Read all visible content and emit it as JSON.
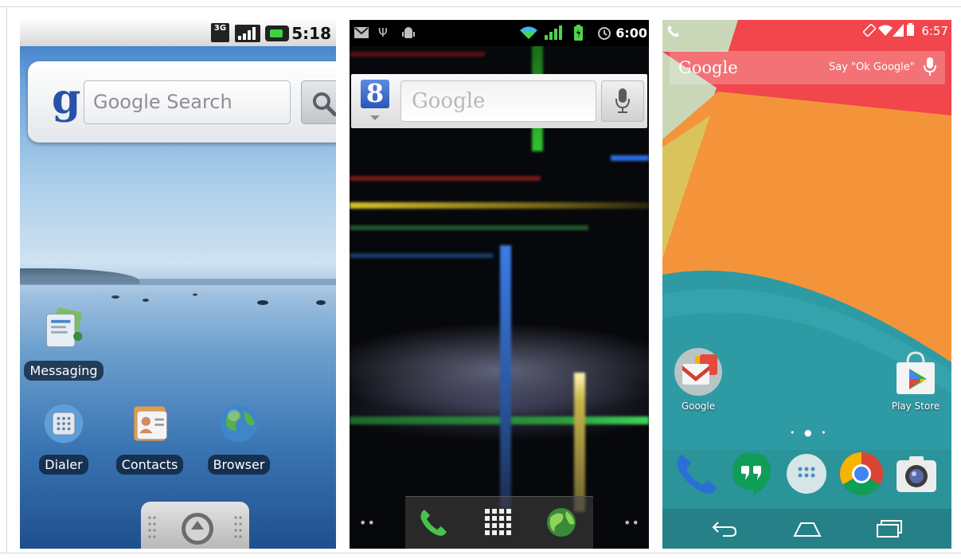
{
  "phone1": {
    "status": {
      "network": "3G",
      "time": "5:18"
    },
    "search": {
      "placeholder": "Google Search",
      "logo": "g"
    },
    "apps": [
      {
        "label": "Messaging",
        "icon": "messaging-icon"
      },
      {
        "label": "Dialer",
        "icon": "dialer-icon"
      },
      {
        "label": "Contacts",
        "icon": "contacts-icon"
      },
      {
        "label": "Browser",
        "icon": "browser-globe-icon"
      }
    ],
    "launcher_icon": "launcher-up-icon"
  },
  "phone2": {
    "status": {
      "time": "6:00"
    },
    "search": {
      "placeholder": "Google",
      "logo": "8"
    },
    "dock": [
      "phone-icon",
      "app-drawer-grid-icon",
      "browser-globe-icon"
    ],
    "page_indicator": "••"
  },
  "phone3": {
    "status": {
      "time": "6:57"
    },
    "search": {
      "label": "Google",
      "hint": "Say \"Ok Google\""
    },
    "apps": [
      {
        "label": "Google",
        "icon": "gmail-folder-icon"
      },
      {
        "label": "Play Store",
        "icon": "play-store-icon"
      }
    ],
    "page_indicator": "• ● •",
    "dock": [
      "phone-icon",
      "hangouts-icon",
      "app-drawer-icon",
      "chrome-icon",
      "camera-icon"
    ],
    "navbar": [
      "back-icon",
      "home-icon",
      "recents-icon"
    ],
    "colors": {
      "red": "#f0464c",
      "orange": "#f4943a",
      "teal": "#2e9aa4",
      "green": "#57a873"
    }
  }
}
